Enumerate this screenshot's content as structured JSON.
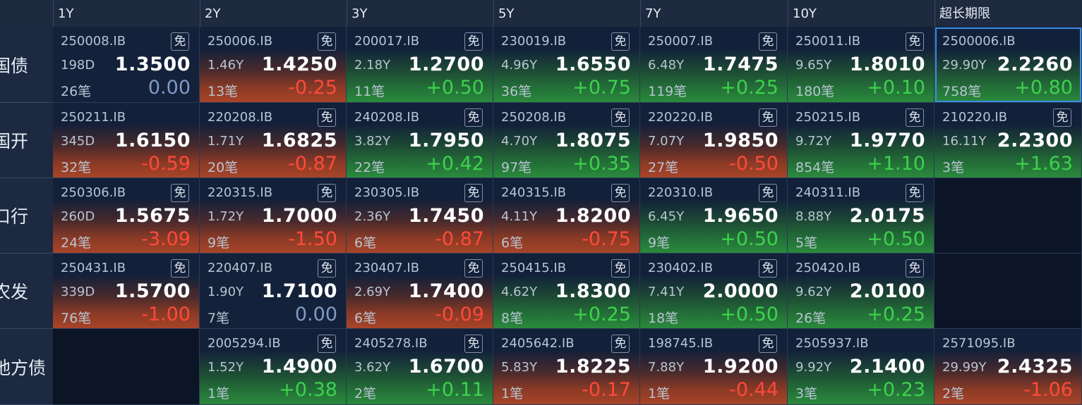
{
  "columns": [
    "1Y",
    "2Y",
    "3Y",
    "5Y",
    "7Y",
    "10Y",
    "超长期限"
  ],
  "rows": [
    {
      "label": "国债",
      "cells": [
        {
          "code": "250008.IB",
          "mian": "免",
          "term": "198D",
          "yield": "1.3500",
          "count": "26笔",
          "change": "0.00",
          "dir": "zero",
          "bg": "neutral"
        },
        {
          "code": "250006.IB",
          "mian": "免",
          "term": "1.46Y",
          "yield": "1.4250",
          "count": "13笔",
          "change": "-0.25",
          "dir": "neg",
          "bg": "red"
        },
        {
          "code": "200017.IB",
          "mian": "免",
          "term": "2.18Y",
          "yield": "1.2700",
          "count": "11笔",
          "change": "+0.50",
          "dir": "pos",
          "bg": "green"
        },
        {
          "code": "230019.IB",
          "mian": "免",
          "term": "4.96Y",
          "yield": "1.6550",
          "count": "36笔",
          "change": "+0.75",
          "dir": "pos",
          "bg": "green"
        },
        {
          "code": "250007.IB",
          "mian": "免",
          "term": "6.48Y",
          "yield": "1.7475",
          "count": "119笔",
          "change": "+0.25",
          "dir": "pos",
          "bg": "green"
        },
        {
          "code": "250011.IB",
          "mian": "免",
          "term": "9.65Y",
          "yield": "1.8010",
          "count": "180笔",
          "change": "+0.10",
          "dir": "pos",
          "bg": "green"
        },
        {
          "code": "2500006.IB",
          "mian": "",
          "term": "29.90Y",
          "yield": "2.2260",
          "count": "758笔",
          "change": "+0.80",
          "dir": "pos",
          "bg": "green",
          "selected": true
        }
      ]
    },
    {
      "label": "国开",
      "cells": [
        {
          "code": "250211.IB",
          "mian": "",
          "term": "345D",
          "yield": "1.6150",
          "count": "32笔",
          "change": "-0.59",
          "dir": "neg",
          "bg": "red"
        },
        {
          "code": "220208.IB",
          "mian": "免",
          "term": "1.71Y",
          "yield": "1.6825",
          "count": "20笔",
          "change": "-0.87",
          "dir": "neg",
          "bg": "red"
        },
        {
          "code": "240208.IB",
          "mian": "免",
          "term": "3.82Y",
          "yield": "1.7950",
          "count": "22笔",
          "change": "+0.42",
          "dir": "pos",
          "bg": "green"
        },
        {
          "code": "250208.IB",
          "mian": "免",
          "term": "4.70Y",
          "yield": "1.8075",
          "count": "97笔",
          "change": "+0.35",
          "dir": "pos",
          "bg": "green"
        },
        {
          "code": "220220.IB",
          "mian": "免",
          "term": "7.07Y",
          "yield": "1.9850",
          "count": "27笔",
          "change": "-0.50",
          "dir": "neg",
          "bg": "red"
        },
        {
          "code": "250215.IB",
          "mian": "免",
          "term": "9.72Y",
          "yield": "1.9770",
          "count": "854笔",
          "change": "+1.10",
          "dir": "pos",
          "bg": "green"
        },
        {
          "code": "210220.IB",
          "mian": "免",
          "term": "16.11Y",
          "yield": "2.2300",
          "count": "3笔",
          "change": "+1.63",
          "dir": "pos",
          "bg": "green"
        }
      ]
    },
    {
      "label": "口行",
      "cells": [
        {
          "code": "250306.IB",
          "mian": "免",
          "term": "260D",
          "yield": "1.5675",
          "count": "24笔",
          "change": "-3.09",
          "dir": "neg",
          "bg": "red"
        },
        {
          "code": "220315.IB",
          "mian": "免",
          "term": "1.72Y",
          "yield": "1.7000",
          "count": "9笔",
          "change": "-1.50",
          "dir": "neg",
          "bg": "red"
        },
        {
          "code": "230305.IB",
          "mian": "免",
          "term": "2.36Y",
          "yield": "1.7450",
          "count": "6笔",
          "change": "-0.87",
          "dir": "neg",
          "bg": "red"
        },
        {
          "code": "240315.IB",
          "mian": "免",
          "term": "4.11Y",
          "yield": "1.8200",
          "count": "6笔",
          "change": "-0.75",
          "dir": "neg",
          "bg": "red"
        },
        {
          "code": "220310.IB",
          "mian": "免",
          "term": "6.45Y",
          "yield": "1.9650",
          "count": "9笔",
          "change": "+0.50",
          "dir": "pos",
          "bg": "green"
        },
        {
          "code": "240311.IB",
          "mian": "免",
          "term": "8.88Y",
          "yield": "2.0175",
          "count": "5笔",
          "change": "+0.50",
          "dir": "pos",
          "bg": "green"
        },
        null
      ]
    },
    {
      "label": "农发",
      "cells": [
        {
          "code": "250431.IB",
          "mian": "免",
          "term": "339D",
          "yield": "1.5700",
          "count": "76笔",
          "change": "-1.00",
          "dir": "neg",
          "bg": "red"
        },
        {
          "code": "220407.IB",
          "mian": "免",
          "term": "1.90Y",
          "yield": "1.7100",
          "count": "7笔",
          "change": "0.00",
          "dir": "zero",
          "bg": "neutral"
        },
        {
          "code": "230407.IB",
          "mian": "免",
          "term": "2.69Y",
          "yield": "1.7400",
          "count": "6笔",
          "change": "-0.09",
          "dir": "neg",
          "bg": "red"
        },
        {
          "code": "250415.IB",
          "mian": "免",
          "term": "4.62Y",
          "yield": "1.8300",
          "count": "8笔",
          "change": "+0.25",
          "dir": "pos",
          "bg": "green"
        },
        {
          "code": "230402.IB",
          "mian": "免",
          "term": "7.41Y",
          "yield": "2.0000",
          "count": "18笔",
          "change": "+0.50",
          "dir": "pos",
          "bg": "green"
        },
        {
          "code": "250420.IB",
          "mian": "免",
          "term": "9.62Y",
          "yield": "2.0100",
          "count": "26笔",
          "change": "+0.25",
          "dir": "pos",
          "bg": "green"
        },
        null
      ]
    },
    {
      "label": "地方债",
      "cells": [
        null,
        {
          "code": "2005294.IB",
          "mian": "免",
          "term": "1.52Y",
          "yield": "1.4900",
          "count": "1笔",
          "change": "+0.38",
          "dir": "pos",
          "bg": "green"
        },
        {
          "code": "2405278.IB",
          "mian": "免",
          "term": "3.62Y",
          "yield": "1.6700",
          "count": "2笔",
          "change": "+0.11",
          "dir": "pos",
          "bg": "green"
        },
        {
          "code": "2405642.IB",
          "mian": "免",
          "term": "5.83Y",
          "yield": "1.8225",
          "count": "1笔",
          "change": "-0.17",
          "dir": "neg",
          "bg": "red"
        },
        {
          "code": "198745.IB",
          "mian": "免",
          "term": "7.88Y",
          "yield": "1.9200",
          "count": "1笔",
          "change": "-0.44",
          "dir": "neg",
          "bg": "red"
        },
        {
          "code": "2505937.IB",
          "mian": "",
          "term": "9.92Y",
          "yield": "2.1400",
          "count": "3笔",
          "change": "+0.23",
          "dir": "pos",
          "bg": "green"
        },
        {
          "code": "2571095.IB",
          "mian": "",
          "term": "29.99Y",
          "yield": "2.4325",
          "count": "2笔",
          "change": "-1.06",
          "dir": "neg",
          "bg": "red"
        }
      ]
    }
  ]
}
